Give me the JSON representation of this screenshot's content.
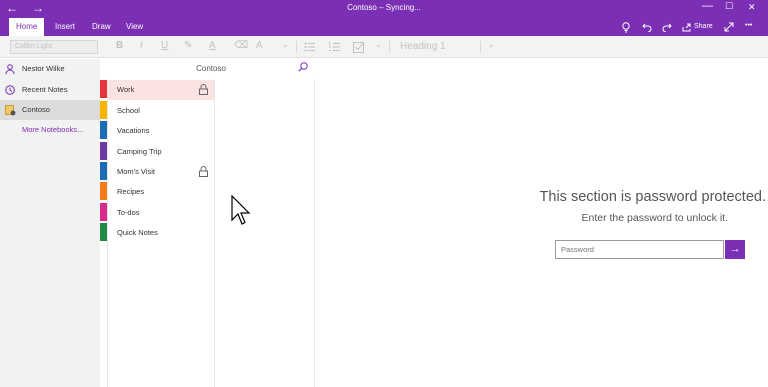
{
  "titlebar": {
    "title": "Contoso – Syncing...",
    "back_icon": "←",
    "forward_icon": "→",
    "min": "—",
    "max": "☐",
    "close": "✕"
  },
  "ribbon": {
    "tabs": [
      "Home",
      "Insert",
      "Draw",
      "View"
    ],
    "share_label": "Share",
    "more": "•••"
  },
  "toolbar": {
    "font_name": "Calibri Light",
    "bold": "B",
    "italic": "I",
    "underline": "U",
    "highlight": "✎",
    "fontcolor": "A",
    "clear": "⌫",
    "styles": "A",
    "dropdown": "⌄",
    "style_value": "Heading 1"
  },
  "leftnav": {
    "items": [
      {
        "label": "Nestor Wilke",
        "icon": "person-icon"
      },
      {
        "label": "Recent Notes",
        "icon": "clock-icon"
      },
      {
        "label": "Contoso",
        "icon": "notebook-icon"
      },
      {
        "label": "More Notebooks..."
      }
    ]
  },
  "sections_panel": {
    "header": "Contoso",
    "items": [
      {
        "label": "Work",
        "color": "#e8353b",
        "locked": true
      },
      {
        "label": "School",
        "color": "#f7b400",
        "locked": false
      },
      {
        "label": "Vacations",
        "color": "#1b6db3",
        "locked": false
      },
      {
        "label": "Camping Trip",
        "color": "#6c3ba2",
        "locked": false
      },
      {
        "label": "Mom's Visit",
        "color": "#1b6db3",
        "locked": true
      },
      {
        "label": "Recipes",
        "color": "#f27c1c",
        "locked": false
      },
      {
        "label": "To-dos",
        "color": "#d82c8c",
        "locked": false
      },
      {
        "label": "Quick Notes",
        "color": "#1e8a42",
        "locked": false
      }
    ]
  },
  "content": {
    "title": "This section is password protected.",
    "subtitle": "Enter the password to unlock it.",
    "password_placeholder": "Password",
    "go_icon": "→"
  },
  "colors": {
    "accent": "#7b2fb4"
  }
}
